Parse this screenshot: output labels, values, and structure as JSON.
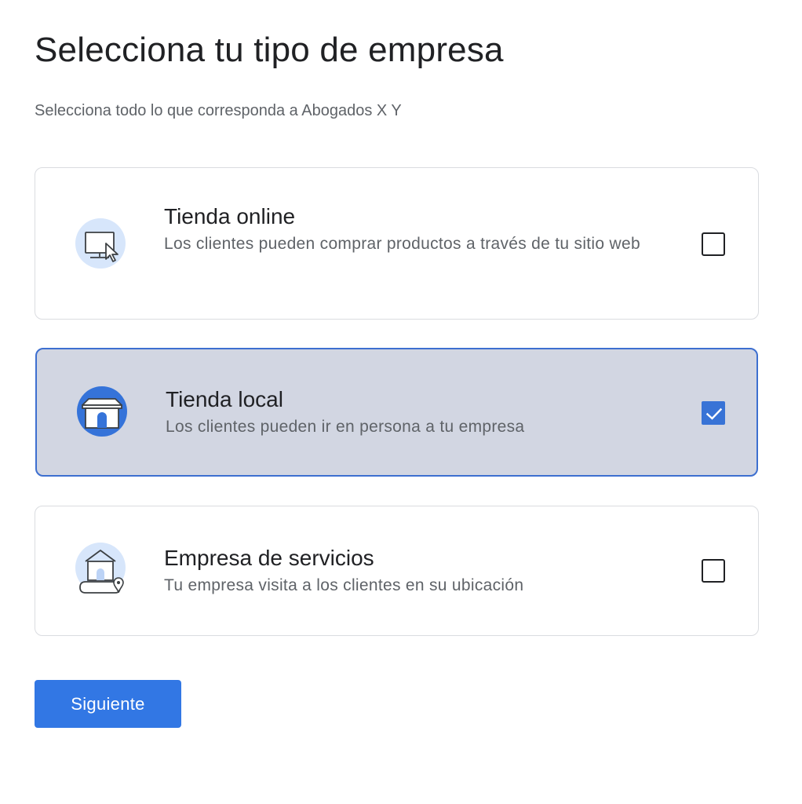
{
  "header": {
    "title": "Selecciona tu tipo de empresa",
    "subtitle": "Selecciona todo lo que corresponda a Abogados X Y"
  },
  "options": [
    {
      "title": "Tienda online",
      "description": "Los clientes pueden comprar productos a través de tu sitio web",
      "checked": false,
      "icon": "computer-cursor-icon"
    },
    {
      "title": "Tienda local",
      "description": "Los clientes pueden ir en persona a tu empresa",
      "checked": true,
      "icon": "storefront-icon"
    },
    {
      "title": "Empresa de servicios",
      "description": "Tu empresa visita a los clientes en su ubicación",
      "checked": false,
      "icon": "house-map-pin-icon"
    }
  ],
  "footer": {
    "next_label": "Siguiente"
  },
  "colors": {
    "accent": "#3277e4",
    "selected_background": "#d2d6e2",
    "selected_border": "#3d6fd0",
    "illustration_light": "#d7e6fb"
  }
}
